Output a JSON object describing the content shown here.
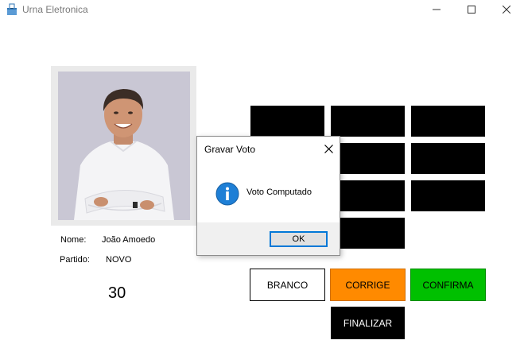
{
  "window": {
    "title": "Urna Eletronica",
    "icon": "ballot-box-icon",
    "controls": [
      "minimize-icon",
      "maximize-icon",
      "close-icon"
    ]
  },
  "candidate": {
    "photo": "candidate-photo",
    "name_label": "Nome:",
    "name_value": "João Amoedo",
    "party_label": "Partido:",
    "party_value": "NOVO",
    "number": "30"
  },
  "keypad": {
    "key_count": 10,
    "key_color": "#000000"
  },
  "actions": {
    "branco": "BRANCO",
    "corrige": "CORRIGE",
    "confirma": "CONFIRMA",
    "finalizar": "FINALIZAR"
  },
  "colors": {
    "corrige": "#ff8a00",
    "confirma": "#00c000",
    "finalizar": "#000000",
    "focus": "#0078d7"
  },
  "dialog": {
    "title": "Gravar Voto",
    "icon": "info-icon",
    "message": "Voto Computado",
    "ok_label": "OK"
  }
}
